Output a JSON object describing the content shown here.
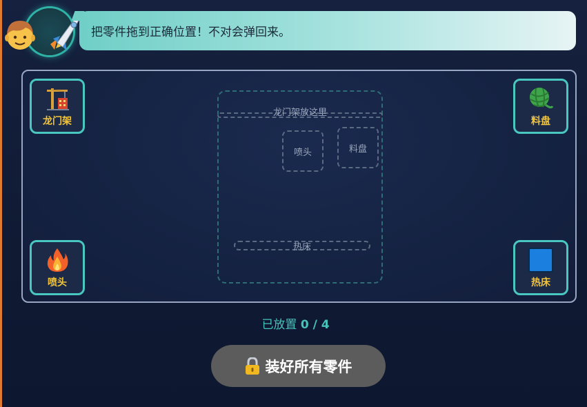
{
  "hint": {
    "text": "把零件拖到正确位置！不对会弹回来。"
  },
  "parts": {
    "gantry": {
      "label": "龙门架",
      "icon": "crane-icon"
    },
    "spool": {
      "label": "料盘",
      "icon": "yarn-spool-icon"
    },
    "nozzle": {
      "label": "喷头",
      "icon": "fire-icon"
    },
    "bed": {
      "label": "热床",
      "icon": "blue-square-icon"
    }
  },
  "machine": {
    "gantry_slot": "龙门架放这里",
    "nozzle_slot": "喷头",
    "spool_slot": "料盘",
    "bed_slot": "热床"
  },
  "progress": {
    "prefix": "已放置",
    "count": "0 / 4"
  },
  "button": {
    "label": "装好所有零件",
    "state": "locked"
  },
  "colors": {
    "accent": "#48c8c0",
    "label": "#f2c43a",
    "button": "#5c5c5c"
  }
}
